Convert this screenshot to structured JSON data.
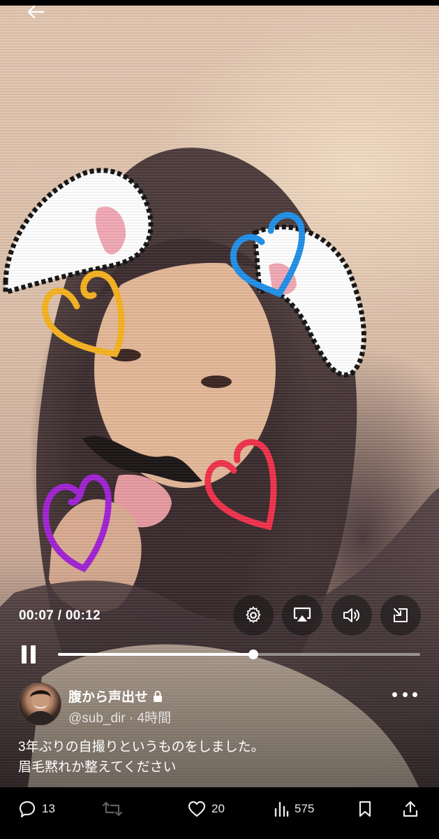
{
  "video": {
    "current_time": "00:07",
    "separator": "/",
    "duration": "00:12",
    "progress": 0.54
  },
  "controls": {
    "icons": [
      "settings-gear-icon",
      "airplay-icon",
      "volume-icon",
      "exit-fullscreen-icon"
    ]
  },
  "post": {
    "display_name": "腹から声出せ",
    "handle": "@sub_dir",
    "dot": "·",
    "time_ago": "4時間",
    "text_line1": "3年ぶりの自撮りというものをしました。",
    "text_line2": "眉毛黙れか整えてください"
  },
  "actions": {
    "reply_count": "13",
    "repost_count": "",
    "like_count": "20",
    "views_count": "575"
  },
  "colors": {
    "heart_yellow": "#f6b21f",
    "heart_blue": "#1f8fe8",
    "heart_red": "#f0304a",
    "heart_purple": "#a021d4",
    "background": "#000000"
  }
}
